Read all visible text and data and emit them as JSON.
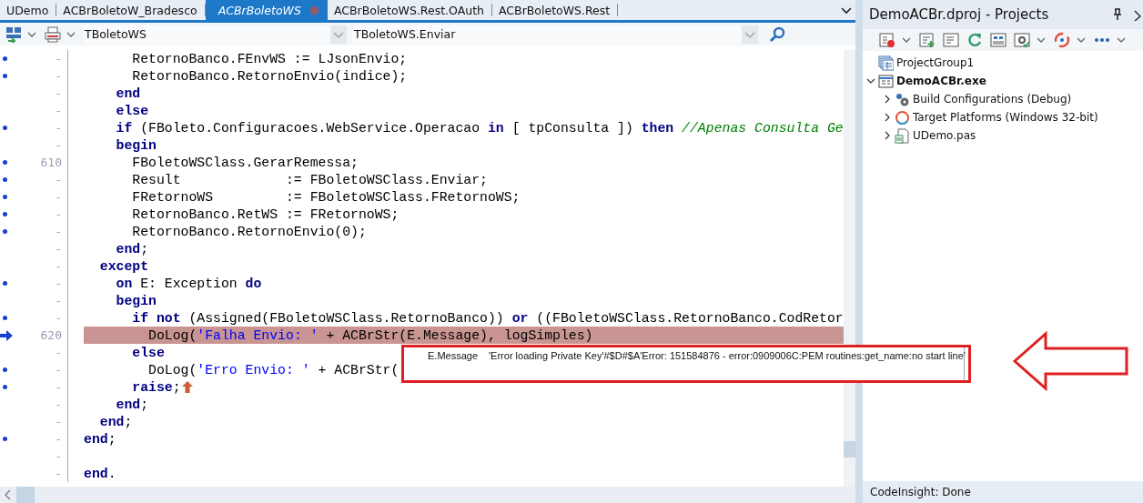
{
  "editor_tabs": [
    {
      "label": "UDemo",
      "selected": false,
      "modified": false
    },
    {
      "label": "ACBrBoletoW_Bradesco",
      "selected": false,
      "modified": false
    },
    {
      "label": "ACBrBoletoWS",
      "selected": true,
      "modified": true
    },
    {
      "label": "ACBrBoletoWS.Rest.OAuth",
      "selected": false,
      "modified": false
    },
    {
      "label": "ACBrBoletoWS.Rest",
      "selected": false,
      "modified": false
    }
  ],
  "editor_toolbar": {
    "class_combo": "TBoletoWS",
    "method_combo": "TBoletoWS.Enviar"
  },
  "code_lines": [
    {
      "gutter": "-",
      "executable": true,
      "current": false,
      "tokens": [
        {
          "kind": "plain",
          "text": "      RetornoBanco.FEnvWS := LJsonEnvio;"
        }
      ]
    },
    {
      "gutter": "-",
      "executable": true,
      "current": false,
      "tokens": [
        {
          "kind": "plain",
          "text": "      RetornoBanco.RetornoEnvio(indice);"
        }
      ]
    },
    {
      "gutter": "-",
      "executable": false,
      "current": false,
      "tokens": [
        {
          "kind": "kw",
          "text": "    end"
        }
      ]
    },
    {
      "gutter": "-",
      "executable": false,
      "current": false,
      "tokens": [
        {
          "kind": "kw",
          "text": "    else"
        }
      ]
    },
    {
      "gutter": "-",
      "executable": true,
      "current": false,
      "tokens": [
        {
          "kind": "kw",
          "text": "    if"
        },
        {
          "kind": "plain",
          "text": " (FBoleto.Configuracoes.WebService.Operacao "
        },
        {
          "kind": "kw",
          "text": "in"
        },
        {
          "kind": "plain",
          "text": " [ tpConsulta ]) "
        },
        {
          "kind": "kw",
          "text": "then "
        },
        {
          "kind": "cmt",
          "text": "//Apenas Consulta Ge"
        }
      ]
    },
    {
      "gutter": "-",
      "executable": false,
      "current": false,
      "tokens": [
        {
          "kind": "kw",
          "text": "    begin"
        }
      ]
    },
    {
      "gutter": "610",
      "executable": true,
      "current": false,
      "tokens": [
        {
          "kind": "plain",
          "text": "      FBoletoWSClass.GerarRemessa;"
        }
      ]
    },
    {
      "gutter": "-",
      "executable": true,
      "current": false,
      "tokens": [
        {
          "kind": "plain",
          "text": "      Result             := FBoletoWSClass.Enviar;"
        }
      ]
    },
    {
      "gutter": "-",
      "executable": true,
      "current": false,
      "tokens": [
        {
          "kind": "plain",
          "text": "      FRetornoWS         := FBoletoWSClass.FRetornoWS;"
        }
      ]
    },
    {
      "gutter": "-",
      "executable": true,
      "current": false,
      "tokens": [
        {
          "kind": "plain",
          "text": "      RetornoBanco.RetWS := FRetornoWS;"
        }
      ]
    },
    {
      "gutter": "-",
      "executable": true,
      "current": false,
      "tokens": [
        {
          "kind": "plain",
          "text": "      RetornoBanco.RetornoEnvio(0);"
        }
      ]
    },
    {
      "gutter": "-",
      "executable": false,
      "current": false,
      "tokens": [
        {
          "kind": "kw",
          "text": "    end"
        },
        {
          "kind": "plain",
          "text": ";"
        }
      ]
    },
    {
      "gutter": "-",
      "executable": false,
      "current": false,
      "tokens": [
        {
          "kind": "kw",
          "text": "  except"
        }
      ]
    },
    {
      "gutter": "-",
      "executable": true,
      "current": false,
      "tokens": [
        {
          "kind": "kw",
          "text": "    on"
        },
        {
          "kind": "plain",
          "text": " E: Exception "
        },
        {
          "kind": "kw",
          "text": "do"
        }
      ]
    },
    {
      "gutter": "-",
      "executable": false,
      "current": false,
      "tokens": [
        {
          "kind": "kw",
          "text": "    begin"
        }
      ]
    },
    {
      "gutter": "-",
      "executable": true,
      "current": false,
      "tokens": [
        {
          "kind": "kw",
          "text": "      if not"
        },
        {
          "kind": "plain",
          "text": " (Assigned(FBoletoWSClass.RetornoBanco)) "
        },
        {
          "kind": "kw",
          "text": "or"
        },
        {
          "kind": "plain",
          "text": " ((FBoletoWSClass.RetornoBanco.CodRetor"
        }
      ]
    },
    {
      "gutter": "620",
      "executable": false,
      "current": true,
      "tokens": [
        {
          "kind": "plain",
          "text": "        DoLog("
        },
        {
          "kind": "str",
          "text": "'Falha Envio: '"
        },
        {
          "kind": "plain",
          "text": " + ACBrStr(E.Message), logSimples)"
        }
      ]
    },
    {
      "gutter": "-",
      "executable": false,
      "current": false,
      "tokens": [
        {
          "kind": "kw",
          "text": "      else"
        }
      ]
    },
    {
      "gutter": "-",
      "executable": true,
      "current": false,
      "tokens": [
        {
          "kind": "plain",
          "text": "        DoLog("
        },
        {
          "kind": "str",
          "text": "'Erro Envio: '"
        },
        {
          "kind": "plain",
          "text": " + ACBrStr("
        }
      ]
    },
    {
      "gutter": "-",
      "executable": true,
      "current": false,
      "raise_marker": true,
      "tokens": [
        {
          "kind": "kw",
          "text": "      raise"
        },
        {
          "kind": "plain",
          "text": ";"
        }
      ]
    },
    {
      "gutter": "-",
      "executable": false,
      "current": false,
      "tokens": [
        {
          "kind": "kw",
          "text": "    end"
        },
        {
          "kind": "plain",
          "text": ";"
        }
      ]
    },
    {
      "gutter": "-",
      "executable": false,
      "current": false,
      "tokens": [
        {
          "kind": "kw",
          "text": "  end"
        },
        {
          "kind": "plain",
          "text": ";"
        }
      ]
    },
    {
      "gutter": "-",
      "executable": true,
      "current": false,
      "tokens": [
        {
          "kind": "kw",
          "text": "end"
        },
        {
          "kind": "plain",
          "text": ";"
        }
      ]
    },
    {
      "gutter": "-",
      "executable": false,
      "current": false
    },
    {
      "gutter": "-",
      "executable": false,
      "current": false,
      "tokens": [
        {
          "kind": "kw",
          "text": "end"
        },
        {
          "kind": "plain",
          "text": "."
        }
      ]
    }
  ],
  "tooltip": {
    "expression": "E.Message",
    "value": "'Error loading Private Key'#$D#$A'Error: 151584876 - error:0909006C:PEM routines:get_name:no start line'"
  },
  "projects": {
    "title": "DemoACBr.dproj - Projects",
    "tree": [
      {
        "label": "ProjectGroup1",
        "kind": "group",
        "active": false
      },
      {
        "label": "DemoACBr.exe",
        "kind": "exe",
        "active": true,
        "expanded": true,
        "children": [
          {
            "label": "Build Configurations (Debug)",
            "kind": "gears",
            "active": false,
            "expanded": false
          },
          {
            "label": "Target Platforms (Windows 32-bit)",
            "kind": "ring",
            "active": false,
            "expanded": false
          },
          {
            "label": "UDemo.pas",
            "kind": "unit",
            "active": false,
            "expanded": false
          }
        ]
      }
    ]
  },
  "status_bar": "CodeInsight: Done"
}
